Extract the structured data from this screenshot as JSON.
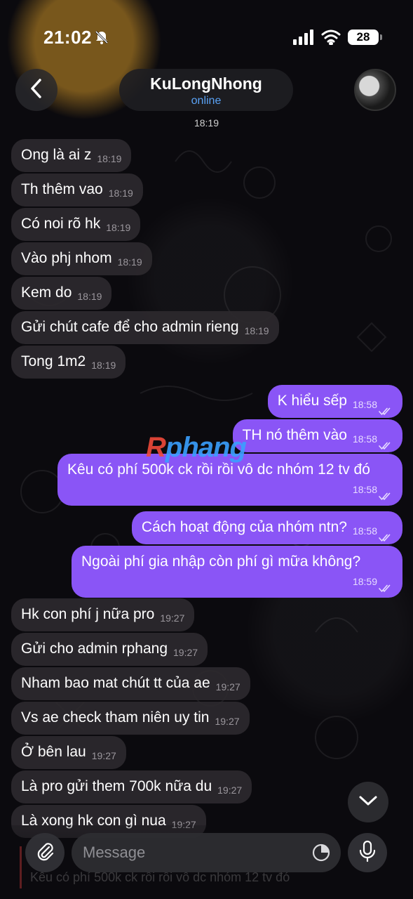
{
  "status_bar": {
    "time": "21:02",
    "battery": "28"
  },
  "header": {
    "title": "KuLongNhong",
    "status": "online"
  },
  "date_stamp": "18:19",
  "messages": [
    {
      "dir": "in",
      "text": "Ong là ai z",
      "time": "18:19"
    },
    {
      "dir": "in",
      "text": "Th thêm vao",
      "time": "18:19"
    },
    {
      "dir": "in",
      "text": "Có noi rõ hk",
      "time": "18:19"
    },
    {
      "dir": "in",
      "text": "Vào phj nhom",
      "time": "18:19"
    },
    {
      "dir": "in",
      "text": "Kem do",
      "time": "18:19"
    },
    {
      "dir": "in",
      "text": "Gửi chút cafe để cho admin rieng",
      "time": "18:19"
    },
    {
      "dir": "in",
      "text": "Tong 1m2",
      "time": "18:19"
    },
    {
      "dir": "out",
      "text": "K hiểu sếp",
      "time": "18:58"
    },
    {
      "dir": "out",
      "text": "TH nó thêm vào",
      "time": "18:58"
    },
    {
      "dir": "out",
      "text": "Kêu có phí 500k ck rồi rồi vô dc nhóm 12 tv đó",
      "time": "18:58"
    },
    {
      "dir": "out",
      "text": "Cách hoạt động của nhóm ntn?",
      "time": "18:58"
    },
    {
      "dir": "out",
      "text": "Ngoài phí gia nhập còn phí gì mữa không?",
      "time": "18:59"
    },
    {
      "dir": "in",
      "text": "Hk con phí j nữa pro",
      "time": "19:27"
    },
    {
      "dir": "in",
      "text": "Gửi cho admin rphang",
      "time": "19:27"
    },
    {
      "dir": "in",
      "text": "Nham bao mat chút tt của ae",
      "time": "19:27"
    },
    {
      "dir": "in",
      "text": "Vs ae check tham niên uy tin",
      "time": "19:27"
    },
    {
      "dir": "in",
      "text": "Ở bên lau",
      "time": "19:27"
    },
    {
      "dir": "in",
      "text": "Là pro gửi them 700k nữa du",
      "time": "19:27"
    },
    {
      "dir": "in",
      "text": "Là xong hk con gì nua",
      "time": "19:27"
    }
  ],
  "watermark": {
    "part1": "R",
    "part2": "phang"
  },
  "reply_preview": {
    "text": "Kêu có phí 500k ck rồi rồi vô dc nhóm 12 tv đó"
  },
  "composer": {
    "placeholder": "Message"
  },
  "colors": {
    "outgoing_bubble": "#8a55f6",
    "incoming_bubble": "#2c292d",
    "online_status": "#5aa2f5"
  },
  "icons": [
    "bell-slash-icon",
    "signal-icon",
    "wifi-icon",
    "chevron-left-icon",
    "chevron-down-icon",
    "paperclip-icon",
    "sticker-icon",
    "microphone-icon",
    "double-check-icon"
  ]
}
